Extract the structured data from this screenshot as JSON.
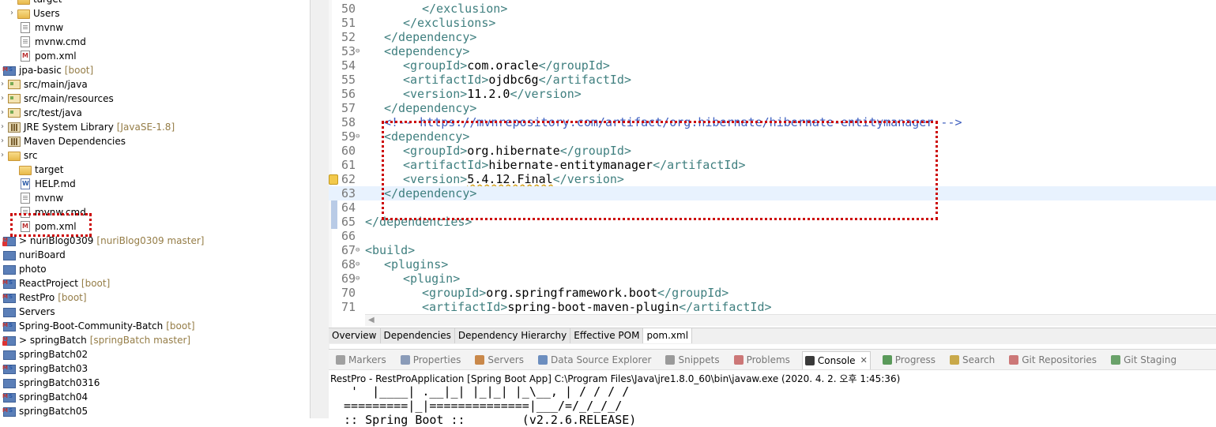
{
  "explorer": {
    "items": [
      {
        "label": "target",
        "deco": "",
        "icon": "folder",
        "chevron": true
      },
      {
        "label": "Users",
        "deco": "",
        "icon": "folder",
        "chevron": true
      },
      {
        "label": "mvnw",
        "deco": "",
        "icon": "file",
        "chevron": false
      },
      {
        "label": "mvnw.cmd",
        "deco": "",
        "icon": "file",
        "chevron": false
      },
      {
        "label": "pom.xml",
        "deco": "",
        "icon": "xml",
        "chevron": false
      },
      {
        "label": "jpa-basic",
        "deco": "[boot]",
        "icon": "mvnproj",
        "chevron": false
      },
      {
        "label": "src/main/java",
        "deco": "",
        "icon": "pkg",
        "chevron": true
      },
      {
        "label": "src/main/resources",
        "deco": "",
        "icon": "pkg",
        "chevron": true
      },
      {
        "label": "src/test/java",
        "deco": "",
        "icon": "pkg",
        "chevron": true
      },
      {
        "label": "JRE System Library",
        "deco": "[JavaSE-1.8]",
        "icon": "lib",
        "chevron": true
      },
      {
        "label": "Maven Dependencies",
        "deco": "",
        "icon": "lib",
        "chevron": true
      },
      {
        "label": "src",
        "deco": "",
        "icon": "folder",
        "chevron": true
      },
      {
        "label": "target",
        "deco": "",
        "icon": "folder",
        "chevron": false
      },
      {
        "label": "HELP.md",
        "deco": "",
        "icon": "word",
        "chevron": false
      },
      {
        "label": "mvnw",
        "deco": "",
        "icon": "file",
        "chevron": false
      },
      {
        "label": "mvnw.cmd",
        "deco": "",
        "icon": "file",
        "chevron": false
      },
      {
        "label": "pom.xml",
        "deco": "",
        "icon": "xml",
        "chevron": false
      },
      {
        "label": "> nuriBlog0309",
        "deco": "[nuriBlog0309 master]",
        "icon": "gitproj",
        "chevron": false
      },
      {
        "label": "nuriBoard",
        "deco": "",
        "icon": "proj",
        "chevron": false
      },
      {
        "label": "photo",
        "deco": "",
        "icon": "proj",
        "chevron": false
      },
      {
        "label": "ReactProject",
        "deco": "[boot]",
        "icon": "mvnproj",
        "chevron": false
      },
      {
        "label": "RestPro",
        "deco": "[boot]",
        "icon": "mvnproj",
        "chevron": false
      },
      {
        "label": "Servers",
        "deco": "",
        "icon": "proj",
        "chevron": false
      },
      {
        "label": "Spring-Boot-Community-Batch",
        "deco": "[boot]",
        "icon": "mvnproj",
        "chevron": false
      },
      {
        "label": "> springBatch",
        "deco": "[springBatch master]",
        "icon": "gitproj",
        "chevron": false
      },
      {
        "label": "springBatch02",
        "deco": "",
        "icon": "proj",
        "chevron": false
      },
      {
        "label": "springBatch03",
        "deco": "",
        "icon": "mvnproj",
        "chevron": false
      },
      {
        "label": "springBatch0316",
        "deco": "",
        "icon": "proj",
        "chevron": false
      },
      {
        "label": "springBatch04",
        "deco": "",
        "icon": "mvnproj",
        "chevron": false
      },
      {
        "label": "springBatch05",
        "deco": "",
        "icon": "mvnproj",
        "chevron": false
      }
    ]
  },
  "editor": {
    "lines": [
      {
        "n": "50",
        "ind": 3,
        "parts": [
          [
            "tag",
            "</exclusion>"
          ]
        ]
      },
      {
        "n": "51",
        "ind": 2,
        "parts": [
          [
            "tag",
            "</exclusions>"
          ]
        ]
      },
      {
        "n": "52",
        "ind": 1,
        "parts": [
          [
            "tag",
            "</dependency>"
          ]
        ]
      },
      {
        "n": "53",
        "ind": 1,
        "fold": true,
        "parts": [
          [
            "tag",
            "<dependency>"
          ]
        ]
      },
      {
        "n": "54",
        "ind": 2,
        "parts": [
          [
            "tag",
            "<groupId>"
          ],
          [
            "txt",
            "com.oracle"
          ],
          [
            "tag",
            "</groupId>"
          ]
        ]
      },
      {
        "n": "55",
        "ind": 2,
        "parts": [
          [
            "tag",
            "<artifactId>"
          ],
          [
            "txt",
            "ojdbc6g"
          ],
          [
            "tag",
            "</artifactId>"
          ]
        ]
      },
      {
        "n": "56",
        "ind": 2,
        "parts": [
          [
            "tag",
            "<version>"
          ],
          [
            "txt",
            "11.2.0"
          ],
          [
            "tag",
            "</version>"
          ]
        ]
      },
      {
        "n": "57",
        "ind": 1,
        "parts": [
          [
            "tag",
            "</dependency>"
          ]
        ]
      },
      {
        "n": "58",
        "ind": 1,
        "parts": [
          [
            "cmt",
            "<!-- https://mvnrepository.com/artifact/org.hibernate/hibernate-entitymanager -->"
          ]
        ]
      },
      {
        "n": "59",
        "ind": 1,
        "fold": true,
        "parts": [
          [
            "tag",
            "<dependency>"
          ]
        ]
      },
      {
        "n": "60",
        "ind": 2,
        "parts": [
          [
            "tag",
            "<groupId>"
          ],
          [
            "txt",
            "org.hibernate"
          ],
          [
            "tag",
            "</groupId>"
          ]
        ]
      },
      {
        "n": "61",
        "ind": 2,
        "parts": [
          [
            "tag",
            "<artifactId>"
          ],
          [
            "txt",
            "hibernate-entitymanager"
          ],
          [
            "tag",
            "</artifactId>"
          ]
        ]
      },
      {
        "n": "62",
        "ind": 2,
        "warn": true,
        "parts": [
          [
            "tag",
            "<version>"
          ],
          [
            "txtu",
            "5.4.12.Final"
          ],
          [
            "tag",
            "</version>"
          ]
        ]
      },
      {
        "n": "63",
        "ind": 1,
        "cur": true,
        "parts": [
          [
            "tag",
            "</dependency>"
          ]
        ]
      },
      {
        "n": "64",
        "ind": 0,
        "parts": []
      },
      {
        "n": "65",
        "ind": 0,
        "parts": [
          [
            "tag",
            "</dependencies>"
          ]
        ]
      },
      {
        "n": "66",
        "ind": 0,
        "parts": []
      },
      {
        "n": "67",
        "ind": 0,
        "fold": true,
        "parts": [
          [
            "tag",
            "<build>"
          ]
        ]
      },
      {
        "n": "68",
        "ind": 1,
        "fold": true,
        "parts": [
          [
            "tag",
            "<plugins>"
          ]
        ]
      },
      {
        "n": "69",
        "ind": 2,
        "fold": true,
        "parts": [
          [
            "tag",
            "<plugin>"
          ]
        ]
      },
      {
        "n": "70",
        "ind": 3,
        "parts": [
          [
            "tag",
            "<groupId>"
          ],
          [
            "txt",
            "org.springframework.boot"
          ],
          [
            "tag",
            "</groupId>"
          ]
        ]
      },
      {
        "n": "71",
        "ind": 3,
        "parts": [
          [
            "tag",
            "<artifactId>"
          ],
          [
            "txt",
            "spring-boot-maven-plugin"
          ],
          [
            "tag",
            "</artifactId>"
          ]
        ]
      }
    ]
  },
  "editor_tabs": [
    "Overview",
    "Dependencies",
    "Dependency Hierarchy",
    "Effective POM",
    "pom.xml"
  ],
  "active_editor_tab": "pom.xml",
  "views": [
    {
      "label": "Markers",
      "icon": "#a0a0a0"
    },
    {
      "label": "Properties",
      "icon": "#8a9bb8"
    },
    {
      "label": "Servers",
      "icon": "#c9884a"
    },
    {
      "label": "Data Source Explorer",
      "icon": "#6c8ebf"
    },
    {
      "label": "Snippets",
      "icon": "#9a9a9a"
    },
    {
      "label": "Problems",
      "icon": "#c77"
    },
    {
      "label": "Console",
      "icon": "#3a3a3a",
      "active": true
    },
    {
      "label": "Progress",
      "icon": "#5a9a5a"
    },
    {
      "label": "Search",
      "icon": "#c9a94a"
    },
    {
      "label": "Git Repositories",
      "icon": "#c77"
    },
    {
      "label": "Git Staging",
      "icon": "#6aa26a"
    }
  ],
  "console": {
    "header": "RestPro - RestProApplication [Spring Boot App] C:\\Program Files\\Java\\jre1.8.0_60\\bin\\javaw.exe (2020. 4. 2. 오후 1:45:36)",
    "lines": [
      "  '  |____| .__|_| |_|_| |_\\__, | / / / /",
      " =========|_|==============|___/=/_/_/_/",
      " :: Spring Boot ::        (v2.2.6.RELEASE)"
    ]
  }
}
